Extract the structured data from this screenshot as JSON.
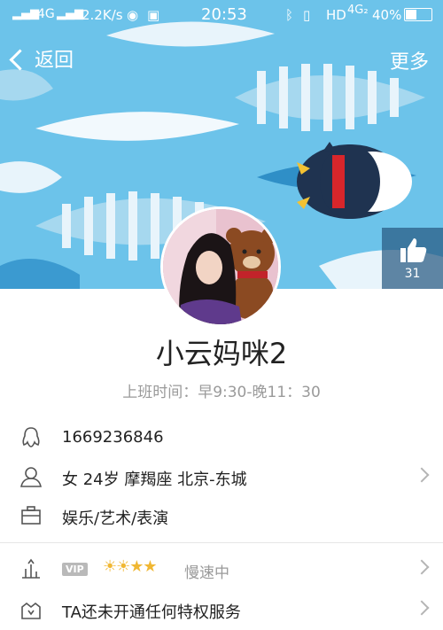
{
  "status_bar": {
    "network": "4G",
    "speed": "2.2K/s",
    "time": "20:53",
    "hd_label": "HD",
    "network2": "4G₂",
    "battery": "40%"
  },
  "nav": {
    "back_label": "返回",
    "more_label": "更多"
  },
  "like": {
    "count": "31"
  },
  "profile": {
    "name": "小云妈咪2",
    "hours": "上班时间：早9:30-晚11：30",
    "qq": "1669236846",
    "info": "女  24岁  摩羯座  北京-东城",
    "occupation": "娱乐/艺术/表演"
  },
  "vip_row": {
    "badge": "VIP",
    "suns": "☀☀★★",
    "status": "慢速中"
  },
  "privilege_row": {
    "text": "TA还未开通任何特权服务"
  },
  "colors": {
    "hero_bg": "#6cc3ea",
    "accent_gold": "#f0b733"
  }
}
